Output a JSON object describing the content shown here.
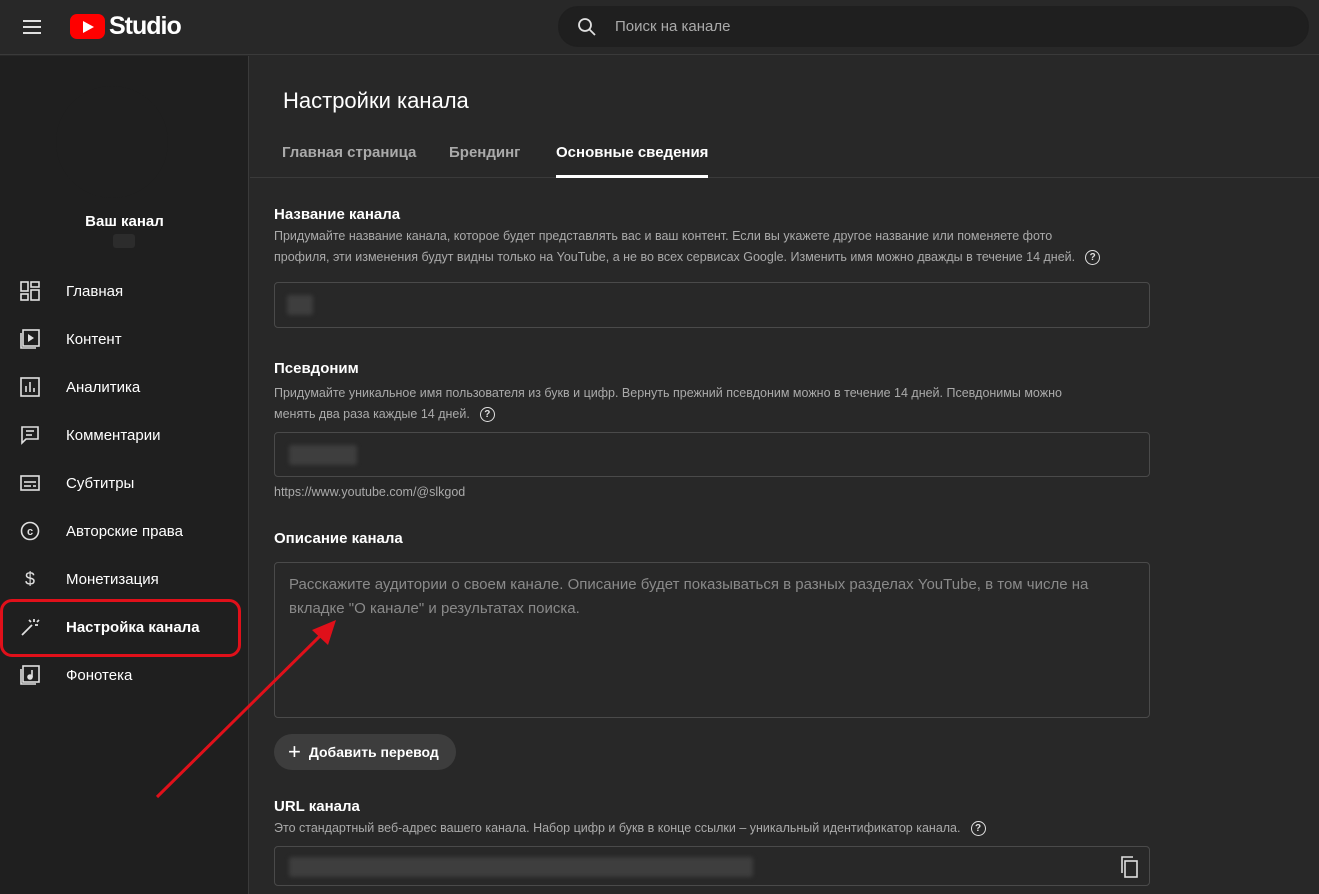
{
  "header": {
    "logo_text": "Studio",
    "search_placeholder": "Поиск на канале"
  },
  "sidebar": {
    "channel_label": "Ваш канал",
    "items": [
      {
        "label": "Главная",
        "icon": "dashboard-icon"
      },
      {
        "label": "Контент",
        "icon": "content-icon"
      },
      {
        "label": "Аналитика",
        "icon": "analytics-icon"
      },
      {
        "label": "Комментарии",
        "icon": "comments-icon"
      },
      {
        "label": "Субтитры",
        "icon": "subtitles-icon"
      },
      {
        "label": "Авторские права",
        "icon": "copyright-icon"
      },
      {
        "label": "Монетизация",
        "icon": "dollar-icon"
      },
      {
        "label": "Настройка канала",
        "icon": "magic-wand-icon"
      },
      {
        "label": "Фонотека",
        "icon": "audio-library-icon"
      }
    ],
    "active_index": 7
  },
  "main": {
    "title": "Настройки канала",
    "tabs": [
      {
        "label": "Главная страница"
      },
      {
        "label": "Брендинг"
      },
      {
        "label": "Основные сведения"
      }
    ],
    "active_tab": 2,
    "name_section": {
      "title": "Название канала",
      "desc_line1": "Придумайте название канала, которое будет представлять вас и ваш контент. Если вы укажете другое название или поменяете фото",
      "desc_line2": "профиля, эти изменения будут видны только на YouTube, а не во всех сервисах Google. Изменить имя можно дважды в течение 14 дней."
    },
    "handle_section": {
      "title": "Псевдоним",
      "desc_line1": "Придумайте уникальное имя пользователя из букв и цифр. Вернуть прежний псевдоним можно в течение 14 дней. Псевдонимы можно",
      "desc_line2": "менять два раза каждые 14 дней.",
      "url_hint": "https://www.youtube.com/@slkgod"
    },
    "description_section": {
      "title": "Описание канала",
      "placeholder": "Расскажите аудитории о своем канале. Описание будет показываться в разных разделах YouTube, в том числе на вкладке \"О канале\" и результатах поиска.",
      "add_translation": "Добавить перевод"
    },
    "url_section": {
      "title": "URL канала",
      "desc": "Это стандартный веб-адрес вашего канала. Набор цифр и букв в конце ссылки – уникальный идентификатор канала."
    }
  },
  "colors": {
    "background": "#282828",
    "sidebar": "#1f1f1f",
    "brand_red": "#ff0000",
    "highlight_red": "#e0101a"
  }
}
